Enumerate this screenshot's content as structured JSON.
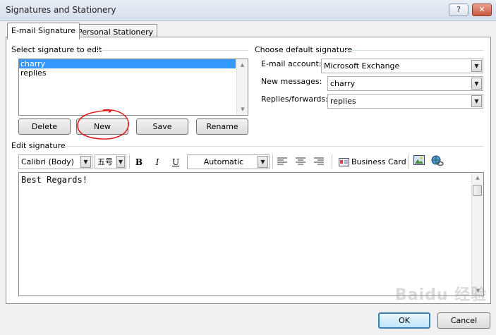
{
  "window": {
    "title": "Signatures and Stationery",
    "help_glyph": "?",
    "close_glyph": "✕"
  },
  "tabs": [
    {
      "label": "E-mail Signature"
    },
    {
      "label": "Personal Stationery"
    }
  ],
  "select": {
    "label": "Select signature to edit",
    "items": [
      {
        "label": "charry",
        "selected": true
      },
      {
        "label": "replies",
        "selected": false
      }
    ]
  },
  "buttons": {
    "delete": "Delete",
    "new": "New",
    "save": "Save",
    "rename": "Rename"
  },
  "defaults": {
    "label": "Choose default signature",
    "email_account_label": "E-mail account:",
    "email_account_value": "Microsoft Exchange",
    "new_messages_label": "New messages:",
    "new_messages_value": "charry",
    "replies_label": "Replies/forwards:",
    "replies_value": "replies"
  },
  "edit": {
    "label": "Edit signature",
    "font": "Calibri (Body)",
    "size": "五号",
    "color": "Automatic",
    "business_card": "Business Card",
    "content": "Best Regards!"
  },
  "footer": {
    "ok": "OK",
    "cancel": "Cancel"
  },
  "watermark": "Baidu 经验",
  "colors": {
    "accent": "#3399ff",
    "annotation": "#e02020"
  }
}
